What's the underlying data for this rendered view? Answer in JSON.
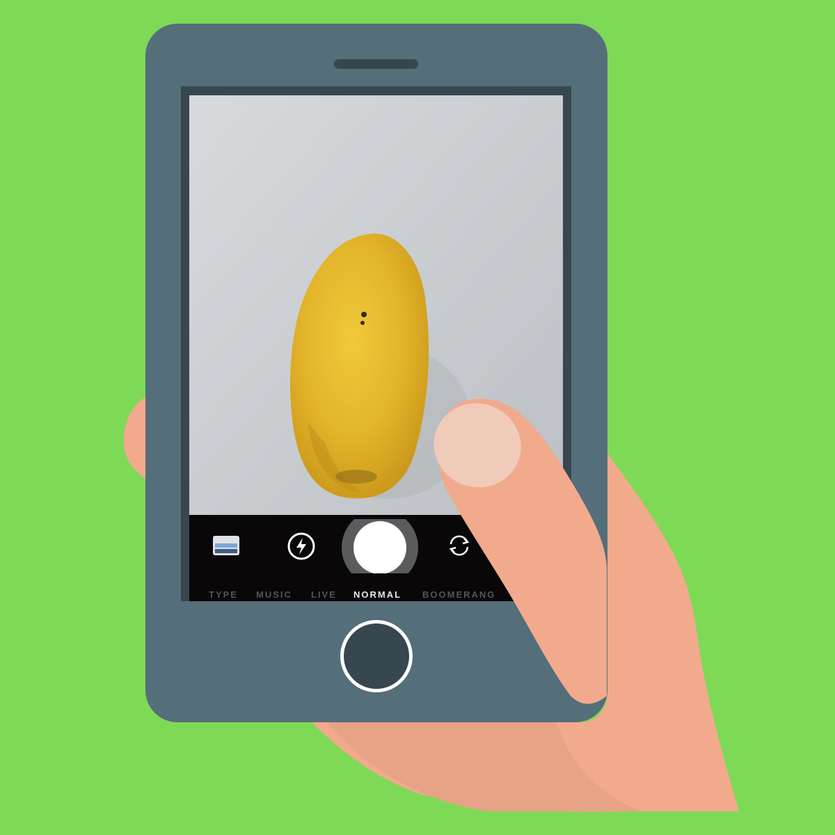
{
  "colors": {
    "background": "#7ed957",
    "phone_body": "#546e7a",
    "phone_dark": "#37474f",
    "skin": "#f2aa8c",
    "skin_shadow": "#e2a285",
    "nail": "#f0cbba",
    "mango": "#e3b52a",
    "control_bar": "#0a0709",
    "mode_inactive": "#55545a",
    "mode_active": "#e8e8ea"
  },
  "camera": {
    "subject": "mango",
    "icons": {
      "gallery": "gallery-thumbnail-icon",
      "flash": "flash-icon",
      "shutter": "shutter-button",
      "switch": "switch-camera-icon"
    },
    "modes": [
      {
        "label": "TYPE",
        "active": false
      },
      {
        "label": "MUSIC",
        "active": false
      },
      {
        "label": "LIVE",
        "active": false
      },
      {
        "label": "NORMAL",
        "active": true
      },
      {
        "label": "BOOMERANG",
        "active": false
      }
    ]
  }
}
